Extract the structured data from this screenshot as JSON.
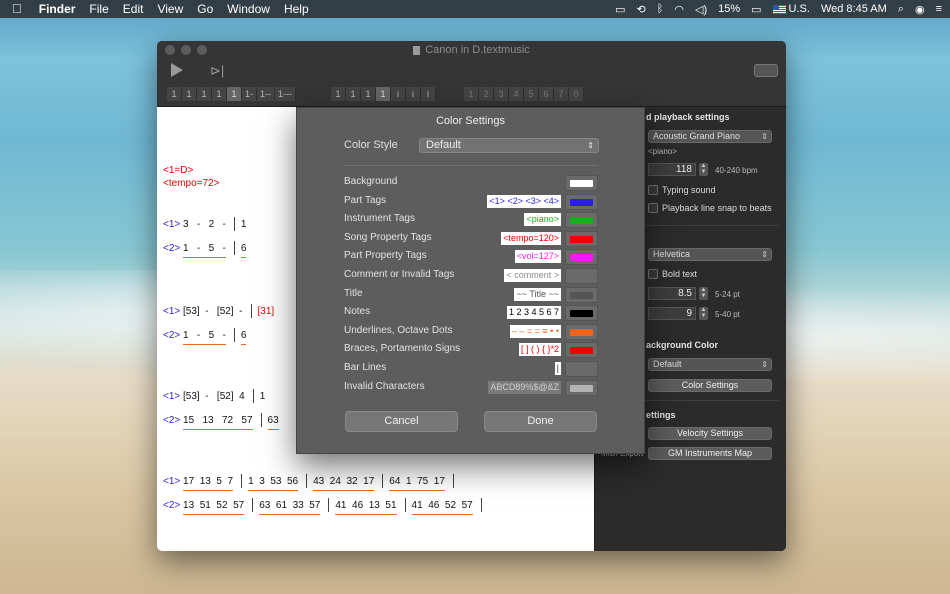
{
  "menubar": {
    "apple": "",
    "items": [
      "Finder",
      "File",
      "Edit",
      "View",
      "Go",
      "Window",
      "Help"
    ],
    "battery": "15%",
    "input_source": "U.S.",
    "clock": "Wed 8:45 AM"
  },
  "window": {
    "title": "Canon in D.textmusic",
    "play_icon": "play-icon",
    "step_icon": "step-play-icon",
    "duration_buttons": [
      "1",
      "1",
      "1",
      "1",
      "1",
      "1-",
      "1--",
      "1---"
    ],
    "dot_buttons": [
      "1",
      "1",
      "1",
      "1",
      "i",
      "i",
      "i"
    ],
    "number_buttons": [
      "1",
      "2",
      "3",
      "4",
      "5",
      "6",
      "7",
      "0"
    ]
  },
  "score": {
    "header_tag": "<1=D>",
    "tempo_tag": "<tempo=72>",
    "lines": [
      {
        "tag": "<1>",
        "notes": "3   -   2   -",
        "after": "1"
      },
      {
        "tag": "<2>",
        "notes": "1   -   5   -",
        "after": "6"
      },
      {
        "tag": "<1>",
        "notes": "[53]  -   [52]  -",
        "after": "[31]"
      },
      {
        "tag": "<2>",
        "notes": "1   -   5   -",
        "after": "6"
      },
      {
        "tag": "<1>",
        "notes": "[53]  -   [52]  4",
        "after": "1"
      },
      {
        "tag": "<2>",
        "notes": "15   13   72   57",
        "after": "63"
      }
    ],
    "full_lines": [
      {
        "tag": "<1>",
        "m1": "17  13  5  7",
        "m2": "1  3  53  56",
        "m3": "43  24  32  17",
        "m4": "64  1  75  17"
      },
      {
        "tag": "<2>",
        "m1": "13  51  52  57",
        "m2": "63  61  33  57",
        "m3": "41  46  13  51",
        "m4": "41  46  52  57"
      }
    ]
  },
  "panel": {
    "section_playback": "d playback settings",
    "instrument": "Acoustic Grand Piano",
    "instrument_tag": "<piano>",
    "tempo_value": "118",
    "tempo_range": "40-240 bpm",
    "typing_sound": "Typing sound",
    "snap_label": "Playback line snap to beats",
    "font": "Helvetica",
    "bold_text": "Bold text",
    "font_size": "8.5",
    "font_size_range": "5-24 pt",
    "spacing": "9",
    "spacing_range": "5-40 pt",
    "section_bg": "ackground Color",
    "bg_style": "Default",
    "color_settings_btn": "Color Settings",
    "section_settings": "ettings",
    "velocity_btn": "Velocity Settings",
    "midi_label": "MIDI Export",
    "gm_btn": "GM Instruments Map"
  },
  "dialog": {
    "title": "Color Settings",
    "style_label": "Color Style",
    "style_value": "Default",
    "rows": [
      {
        "label": "Background",
        "preview": "",
        "color": "#ffffff"
      },
      {
        "label": "Part Tags",
        "preview": "<1> <2> <3> <4>",
        "color": "#2a1fe8"
      },
      {
        "label": "Instrument Tags",
        "preview": "<piano>",
        "color": "#16b01e"
      },
      {
        "label": "Song Property Tags",
        "preview": "<tempo=120>",
        "color": "#f00000"
      },
      {
        "label": "Part Property Tags",
        "preview": "<vol=127>",
        "color": "#f01ee8"
      },
      {
        "label": "Comment or Invalid Tags",
        "preview": "< comment >",
        "color": "#6a6a6a"
      },
      {
        "label": "Title",
        "preview": "~~ Title ~~",
        "color": "#555555"
      },
      {
        "label": "Notes",
        "preview": "1 2 3 4 5 6 7",
        "color": "#000000"
      },
      {
        "label": "Underlines, Octave Dots",
        "preview": "– – = = ≡ • •",
        "color": "#f0641e"
      },
      {
        "label": "Braces, Portamento Signs",
        "preview": "[ ]  ( )  { }*2",
        "color": "#f00000"
      },
      {
        "label": "Bar Lines",
        "preview": "|",
        "color": "#6a6a6a"
      },
      {
        "label": "Invalid Characters",
        "preview": "ABCD89%$@&Z",
        "color": "#b4b4b4"
      }
    ],
    "cancel": "Cancel",
    "done": "Done"
  }
}
